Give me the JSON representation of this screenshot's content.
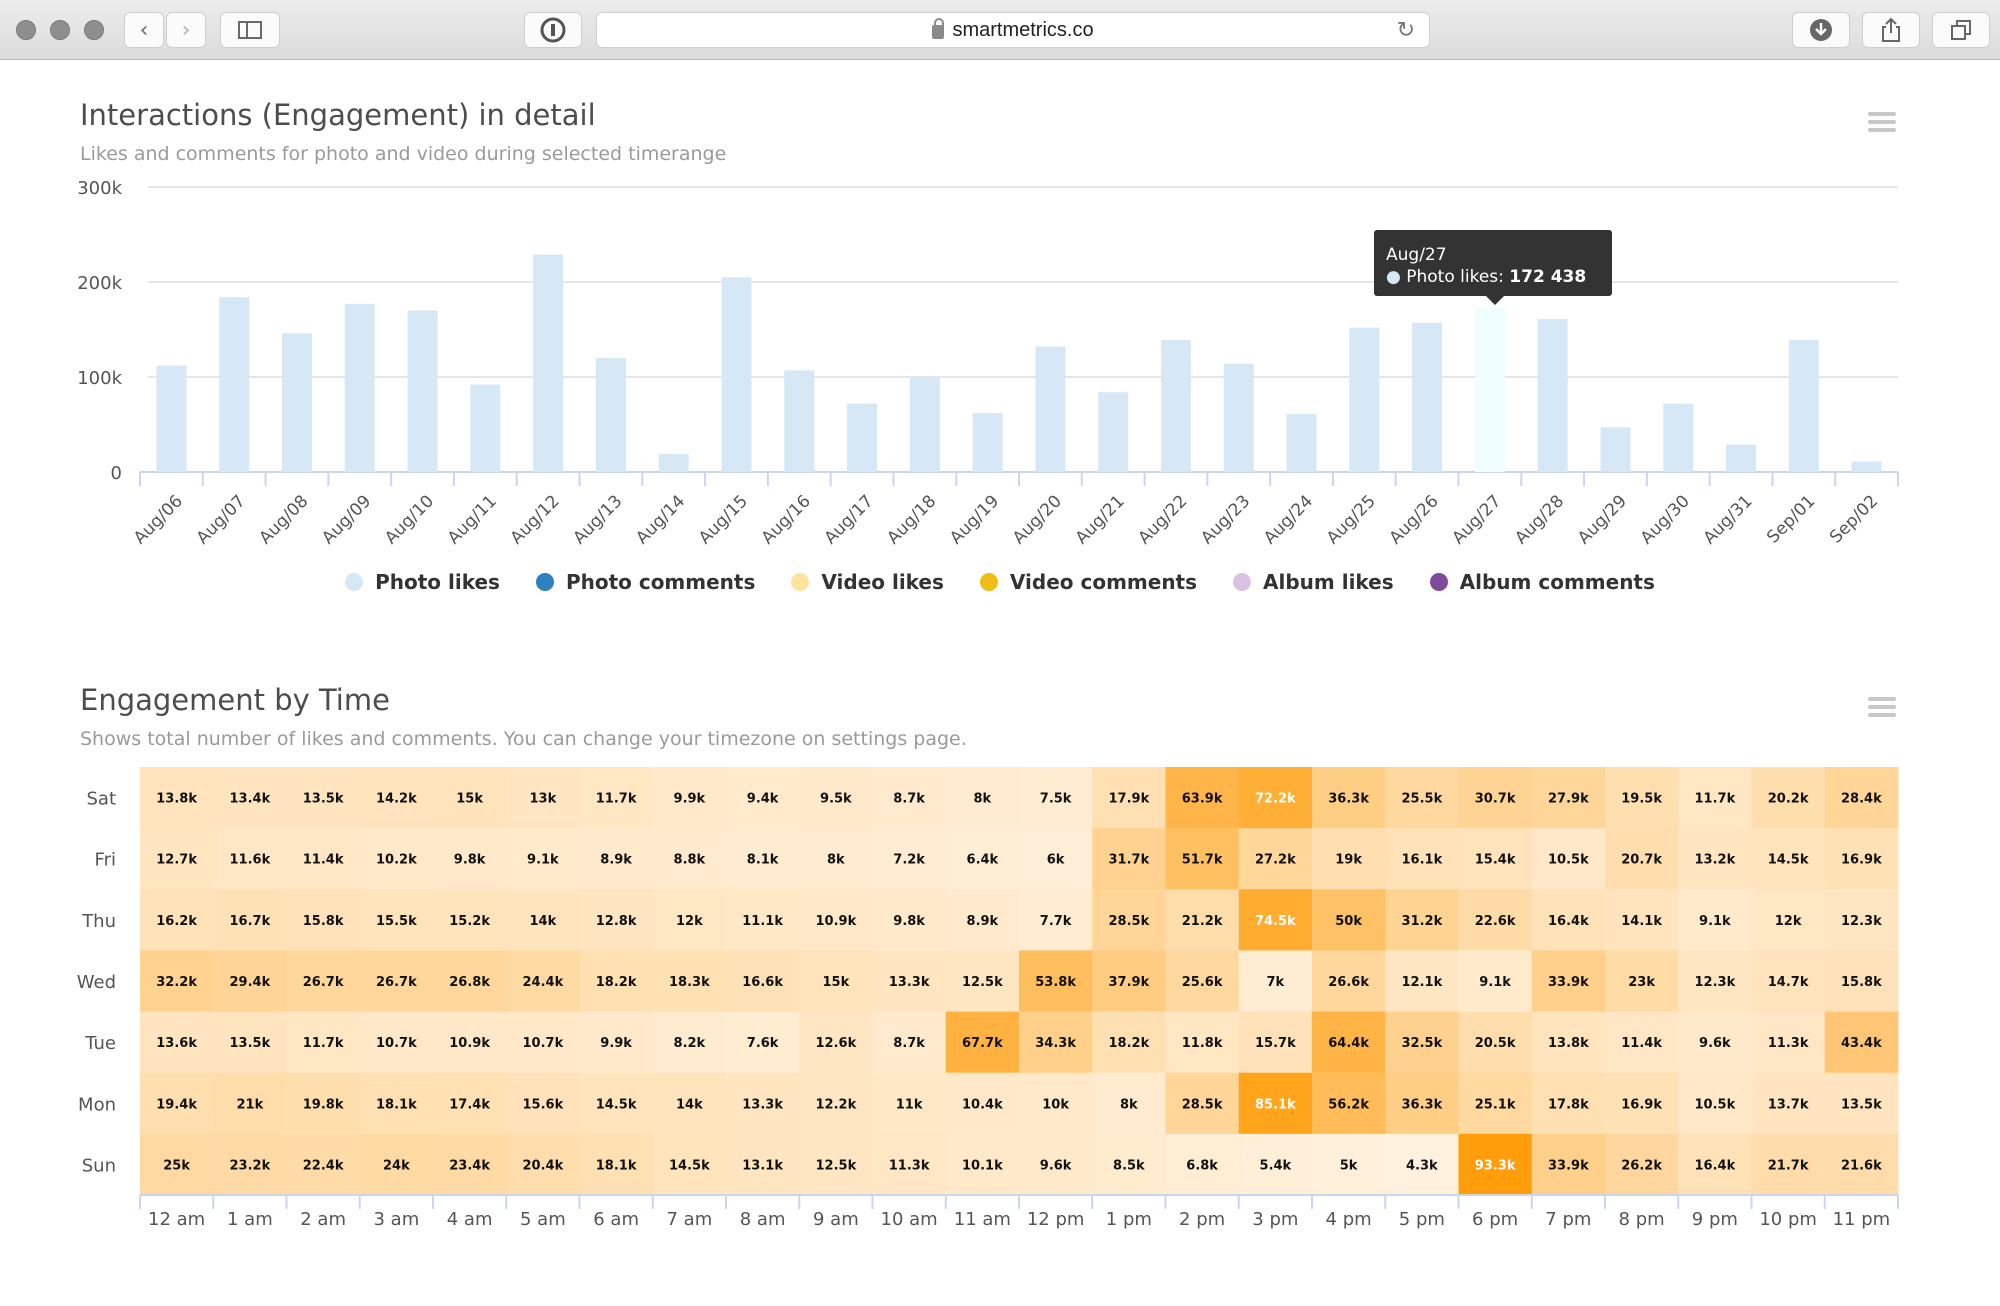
{
  "browser": {
    "url": "smartmetrics.co",
    "icons": [
      "back-icon",
      "forward-icon",
      "sidebar-icon",
      "password-icon",
      "lock-icon",
      "reload-icon",
      "download-icon",
      "share-icon",
      "tabs-icon"
    ]
  },
  "chart1": {
    "title": "Interactions (Engagement) in detail",
    "subtitle": "Likes and comments for photo and video during selected timerange",
    "tooltip": {
      "date": "Aug/27",
      "series": "Photo likes:",
      "value": "172 438"
    },
    "legend": [
      {
        "label": "Photo likes",
        "color": "#d6e8f6"
      },
      {
        "label": "Photo comments",
        "color": "#2f80c1"
      },
      {
        "label": "Video likes",
        "color": "#fde39b"
      },
      {
        "label": "Video comments",
        "color": "#f0bd14"
      },
      {
        "label": "Album likes",
        "color": "#dac2e2"
      },
      {
        "label": "Album comments",
        "color": "#7f4a9b"
      }
    ]
  },
  "chart_data": [
    {
      "type": "bar",
      "title": "Interactions (Engagement) in detail",
      "subtitle": "Likes and comments for photo and video during selected timerange",
      "xlabel": "",
      "ylabel": "",
      "ylim": [
        0,
        300000
      ],
      "yticks": [
        0,
        100000,
        200000,
        300000
      ],
      "ytick_labels": [
        "0",
        "100k",
        "200k",
        "300k"
      ],
      "grid": true,
      "legend_position": "bottom",
      "categories": [
        "Aug/06",
        "Aug/07",
        "Aug/08",
        "Aug/09",
        "Aug/10",
        "Aug/11",
        "Aug/12",
        "Aug/13",
        "Aug/14",
        "Aug/15",
        "Aug/16",
        "Aug/17",
        "Aug/18",
        "Aug/19",
        "Aug/20",
        "Aug/21",
        "Aug/22",
        "Aug/23",
        "Aug/24",
        "Aug/25",
        "Aug/26",
        "Aug/27",
        "Aug/28",
        "Aug/29",
        "Aug/30",
        "Aug/31",
        "Sep/01",
        "Sep/02"
      ],
      "series": [
        {
          "name": "Photo likes",
          "color": "#d6e8f6",
          "highlight_color": "#f0feff",
          "values": [
            112000,
            184000,
            146000,
            177000,
            170000,
            92000,
            229000,
            120000,
            19000,
            205000,
            107000,
            72000,
            99000,
            62000,
            132000,
            84000,
            139000,
            114000,
            61000,
            152000,
            157000,
            172438,
            161000,
            47000,
            72000,
            29000,
            139000,
            11000
          ]
        },
        {
          "name": "Photo comments",
          "color": "#2f80c1",
          "values": []
        },
        {
          "name": "Video likes",
          "color": "#fde39b",
          "values": []
        },
        {
          "name": "Video comments",
          "color": "#f0bd14",
          "values": []
        },
        {
          "name": "Album likes",
          "color": "#dac2e2",
          "values": []
        },
        {
          "name": "Album comments",
          "color": "#7f4a9b",
          "values": []
        }
      ],
      "highlighted_category": "Aug/27"
    },
    {
      "type": "heatmap",
      "title": "Engagement by Time",
      "subtitle": "Shows total number of likes and comments. You can change your timezone on settings page.",
      "x": [
        "12 am",
        "1 am",
        "2 am",
        "3 am",
        "4 am",
        "5 am",
        "6 am",
        "7 am",
        "8 am",
        "9 am",
        "10 am",
        "11 am",
        "12 pm",
        "1 pm",
        "2 pm",
        "3 pm",
        "4 pm",
        "5 pm",
        "6 pm",
        "7 pm",
        "8 pm",
        "9 pm",
        "10 pm",
        "11 pm"
      ],
      "y": [
        "Sat",
        "Fri",
        "Thu",
        "Wed",
        "Tue",
        "Mon",
        "Sun"
      ],
      "color_min": "#fff1de",
      "color_max": "#ff9d0a",
      "values": [
        [
          "13.8k",
          "13.4k",
          "13.5k",
          "14.2k",
          "15k",
          "13k",
          "11.7k",
          "9.9k",
          "9.4k",
          "9.5k",
          "8.7k",
          "8k",
          "7.5k",
          "17.9k",
          "63.9k",
          "72.2k",
          "36.3k",
          "25.5k",
          "30.7k",
          "27.9k",
          "19.5k",
          "11.7k",
          "20.2k",
          "28.4k"
        ],
        [
          "12.7k",
          "11.6k",
          "11.4k",
          "10.2k",
          "9.8k",
          "9.1k",
          "8.9k",
          "8.8k",
          "8.1k",
          "8k",
          "7.2k",
          "6.4k",
          "6k",
          "31.7k",
          "51.7k",
          "27.2k",
          "19k",
          "16.1k",
          "15.4k",
          "10.5k",
          "20.7k",
          "13.2k",
          "14.5k",
          "16.9k"
        ],
        [
          "16.2k",
          "16.7k",
          "15.8k",
          "15.5k",
          "15.2k",
          "14k",
          "12.8k",
          "12k",
          "11.1k",
          "10.9k",
          "9.8k",
          "8.9k",
          "7.7k",
          "28.5k",
          "21.2k",
          "74.5k",
          "50k",
          "31.2k",
          "22.6k",
          "16.4k",
          "14.1k",
          "9.1k",
          "12k",
          "12.3k"
        ],
        [
          "32.2k",
          "29.4k",
          "26.7k",
          "26.7k",
          "26.8k",
          "24.4k",
          "18.2k",
          "18.3k",
          "16.6k",
          "15k",
          "13.3k",
          "12.5k",
          "53.8k",
          "37.9k",
          "25.6k",
          "7k",
          "26.6k",
          "12.1k",
          "9.1k",
          "33.9k",
          "23k",
          "12.3k",
          "14.7k",
          "15.8k"
        ],
        [
          "13.6k",
          "13.5k",
          "11.7k",
          "10.7k",
          "10.9k",
          "10.7k",
          "9.9k",
          "8.2k",
          "7.6k",
          "12.6k",
          "8.7k",
          "67.7k",
          "34.3k",
          "18.2k",
          "11.8k",
          "15.7k",
          "64.4k",
          "32.5k",
          "20.5k",
          "13.8k",
          "11.4k",
          "9.6k",
          "11.3k",
          "43.4k"
        ],
        [
          "19.4k",
          "21k",
          "19.8k",
          "18.1k",
          "17.4k",
          "15.6k",
          "14.5k",
          "14k",
          "13.3k",
          "12.2k",
          "11k",
          "10.4k",
          "10k",
          "8k",
          "28.5k",
          "85.1k",
          "56.2k",
          "36.3k",
          "25.1k",
          "17.8k",
          "16.9k",
          "10.5k",
          "13.7k",
          "13.5k"
        ],
        [
          "25k",
          "23.2k",
          "22.4k",
          "24k",
          "23.4k",
          "20.4k",
          "18.1k",
          "14.5k",
          "13.1k",
          "12.5k",
          "11.3k",
          "10.1k",
          "9.6k",
          "8.5k",
          "6.8k",
          "5.4k",
          "5k",
          "4.3k",
          "93.3k",
          "33.9k",
          "26.2k",
          "16.4k",
          "21.7k",
          "21.6k"
        ]
      ],
      "grid": false
    }
  ],
  "chart2": {
    "title": "Engagement by Time",
    "subtitle": "Shows total number of likes and comments. You can change your timezone on settings page."
  }
}
